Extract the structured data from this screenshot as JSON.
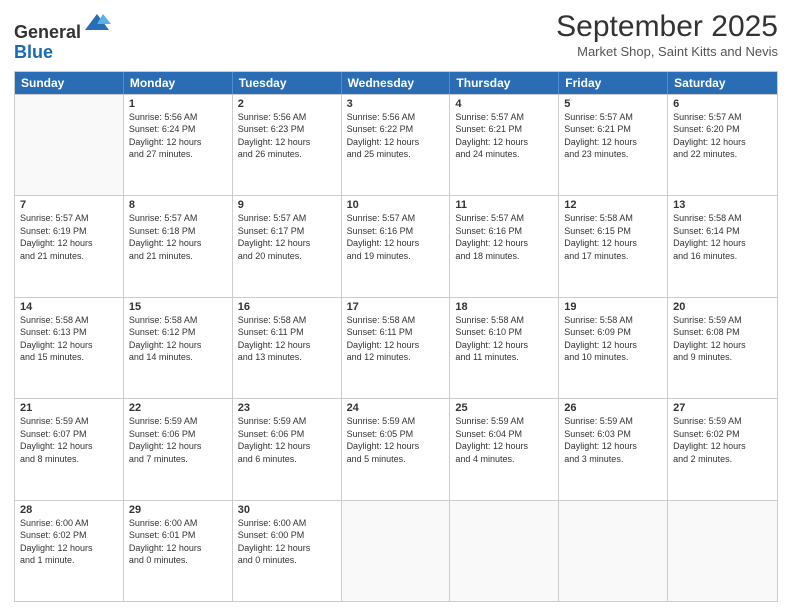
{
  "logo": {
    "line1": "General",
    "line2": "Blue"
  },
  "title": "September 2025",
  "subtitle": "Market Shop, Saint Kitts and Nevis",
  "header_days": [
    "Sunday",
    "Monday",
    "Tuesday",
    "Wednesday",
    "Thursday",
    "Friday",
    "Saturday"
  ],
  "weeks": [
    [
      {
        "day": "",
        "info": ""
      },
      {
        "day": "1",
        "info": "Sunrise: 5:56 AM\nSunset: 6:24 PM\nDaylight: 12 hours\nand 27 minutes."
      },
      {
        "day": "2",
        "info": "Sunrise: 5:56 AM\nSunset: 6:23 PM\nDaylight: 12 hours\nand 26 minutes."
      },
      {
        "day": "3",
        "info": "Sunrise: 5:56 AM\nSunset: 6:22 PM\nDaylight: 12 hours\nand 25 minutes."
      },
      {
        "day": "4",
        "info": "Sunrise: 5:57 AM\nSunset: 6:21 PM\nDaylight: 12 hours\nand 24 minutes."
      },
      {
        "day": "5",
        "info": "Sunrise: 5:57 AM\nSunset: 6:21 PM\nDaylight: 12 hours\nand 23 minutes."
      },
      {
        "day": "6",
        "info": "Sunrise: 5:57 AM\nSunset: 6:20 PM\nDaylight: 12 hours\nand 22 minutes."
      }
    ],
    [
      {
        "day": "7",
        "info": "Sunrise: 5:57 AM\nSunset: 6:19 PM\nDaylight: 12 hours\nand 21 minutes."
      },
      {
        "day": "8",
        "info": "Sunrise: 5:57 AM\nSunset: 6:18 PM\nDaylight: 12 hours\nand 21 minutes."
      },
      {
        "day": "9",
        "info": "Sunrise: 5:57 AM\nSunset: 6:17 PM\nDaylight: 12 hours\nand 20 minutes."
      },
      {
        "day": "10",
        "info": "Sunrise: 5:57 AM\nSunset: 6:16 PM\nDaylight: 12 hours\nand 19 minutes."
      },
      {
        "day": "11",
        "info": "Sunrise: 5:57 AM\nSunset: 6:16 PM\nDaylight: 12 hours\nand 18 minutes."
      },
      {
        "day": "12",
        "info": "Sunrise: 5:58 AM\nSunset: 6:15 PM\nDaylight: 12 hours\nand 17 minutes."
      },
      {
        "day": "13",
        "info": "Sunrise: 5:58 AM\nSunset: 6:14 PM\nDaylight: 12 hours\nand 16 minutes."
      }
    ],
    [
      {
        "day": "14",
        "info": "Sunrise: 5:58 AM\nSunset: 6:13 PM\nDaylight: 12 hours\nand 15 minutes."
      },
      {
        "day": "15",
        "info": "Sunrise: 5:58 AM\nSunset: 6:12 PM\nDaylight: 12 hours\nand 14 minutes."
      },
      {
        "day": "16",
        "info": "Sunrise: 5:58 AM\nSunset: 6:11 PM\nDaylight: 12 hours\nand 13 minutes."
      },
      {
        "day": "17",
        "info": "Sunrise: 5:58 AM\nSunset: 6:11 PM\nDaylight: 12 hours\nand 12 minutes."
      },
      {
        "day": "18",
        "info": "Sunrise: 5:58 AM\nSunset: 6:10 PM\nDaylight: 12 hours\nand 11 minutes."
      },
      {
        "day": "19",
        "info": "Sunrise: 5:58 AM\nSunset: 6:09 PM\nDaylight: 12 hours\nand 10 minutes."
      },
      {
        "day": "20",
        "info": "Sunrise: 5:59 AM\nSunset: 6:08 PM\nDaylight: 12 hours\nand 9 minutes."
      }
    ],
    [
      {
        "day": "21",
        "info": "Sunrise: 5:59 AM\nSunset: 6:07 PM\nDaylight: 12 hours\nand 8 minutes."
      },
      {
        "day": "22",
        "info": "Sunrise: 5:59 AM\nSunset: 6:06 PM\nDaylight: 12 hours\nand 7 minutes."
      },
      {
        "day": "23",
        "info": "Sunrise: 5:59 AM\nSunset: 6:06 PM\nDaylight: 12 hours\nand 6 minutes."
      },
      {
        "day": "24",
        "info": "Sunrise: 5:59 AM\nSunset: 6:05 PM\nDaylight: 12 hours\nand 5 minutes."
      },
      {
        "day": "25",
        "info": "Sunrise: 5:59 AM\nSunset: 6:04 PM\nDaylight: 12 hours\nand 4 minutes."
      },
      {
        "day": "26",
        "info": "Sunrise: 5:59 AM\nSunset: 6:03 PM\nDaylight: 12 hours\nand 3 minutes."
      },
      {
        "day": "27",
        "info": "Sunrise: 5:59 AM\nSunset: 6:02 PM\nDaylight: 12 hours\nand 2 minutes."
      }
    ],
    [
      {
        "day": "28",
        "info": "Sunrise: 6:00 AM\nSunset: 6:02 PM\nDaylight: 12 hours\nand 1 minute."
      },
      {
        "day": "29",
        "info": "Sunrise: 6:00 AM\nSunset: 6:01 PM\nDaylight: 12 hours\nand 0 minutes."
      },
      {
        "day": "30",
        "info": "Sunrise: 6:00 AM\nSunset: 6:00 PM\nDaylight: 12 hours\nand 0 minutes."
      },
      {
        "day": "",
        "info": ""
      },
      {
        "day": "",
        "info": ""
      },
      {
        "day": "",
        "info": ""
      },
      {
        "day": "",
        "info": ""
      }
    ]
  ]
}
